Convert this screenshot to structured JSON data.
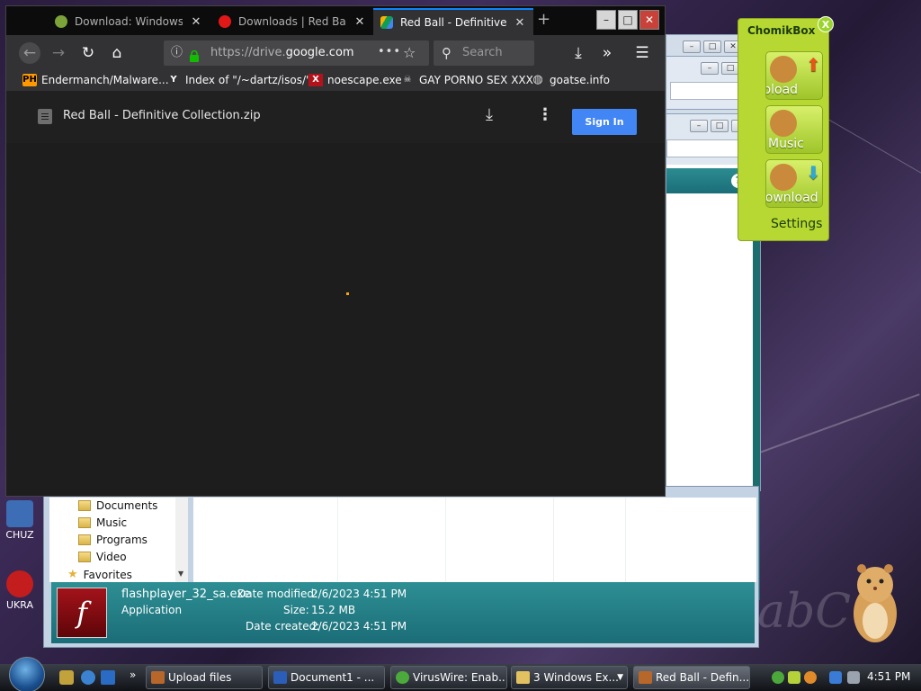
{
  "firefox": {
    "tabs": [
      {
        "label": "Download: Windows"
      },
      {
        "label": "Downloads | Red Ball"
      },
      {
        "label": "Red Ball - Definitive Co"
      }
    ],
    "new_tab": "+",
    "url_prefix": "https://drive.",
    "url_domain": "google.com",
    "url_more": "•••",
    "search_placeholder": "Search",
    "bookmarks": [
      {
        "label": "Endermanch/Malware...",
        "icon": "PH"
      },
      {
        "label": "Index of \"/~dartz/isos/\"",
        "icon": "Y"
      },
      {
        "label": "noescape.exe",
        "icon": "X"
      },
      {
        "label": "GAY PORNO SEX XXX",
        "icon": "skull-icon"
      },
      {
        "label": "goatse.info",
        "icon": "globe-icon"
      }
    ]
  },
  "drive": {
    "filename": "Red Ball - Definitive Collection.zip",
    "sign_in": "Sign In"
  },
  "explorer": {
    "tree": [
      "Documents",
      "Music",
      "Programs",
      "Video",
      "Favorites"
    ],
    "details": {
      "file_name": "flashplayer_32_sa.exe",
      "file_type": "Application",
      "date_modified_label": "Date modified:",
      "date_modified": "2/6/2023 4:51 PM",
      "size_label": "Size:",
      "size": "15.2 MB",
      "date_created_label": "Date created:",
      "date_created": "2/6/2023 4:51 PM"
    }
  },
  "chomikbox": {
    "title": "ChomikBox",
    "close": "X",
    "upload": "Upload",
    "music": "Music",
    "download": "Download",
    "settings": "Settings"
  },
  "desktop": {
    "icons": [
      "CHUZ",
      "UKRA"
    ],
    "watermark": "abC"
  },
  "taskbar": {
    "items": [
      {
        "label": "Upload files"
      },
      {
        "label": "Document1 - ..."
      },
      {
        "label": "VirusWire: Enab..."
      },
      {
        "label": "3 Windows Ex..."
      },
      {
        "label": "Red Ball - Defin..."
      }
    ],
    "more": "»",
    "clock": "4:51 PM"
  },
  "colors": {
    "firefox_accent": "#0a84ff",
    "signin_blue": "#4285f4",
    "chomik_green": "#b7d832",
    "details_teal": "#1f7c84"
  }
}
